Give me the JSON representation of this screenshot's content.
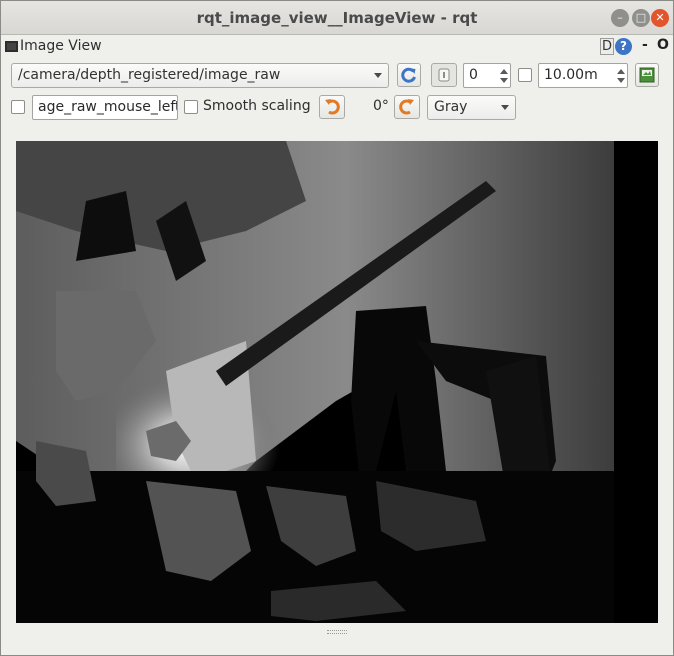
{
  "window": {
    "title": "rqt_image_view__ImageView - rqt",
    "minimize_glyph": "–",
    "maximize_glyph": "□",
    "close_glyph": "✕"
  },
  "plugin": {
    "title": "Image View",
    "d_button": "D",
    "help_glyph": "?",
    "dash_glyph": "-",
    "o_glyph": "O"
  },
  "toolbar1": {
    "topic": "/camera/depth_registered/image_raw",
    "spin_value": "0",
    "max_value": "10.00m"
  },
  "toolbar2": {
    "mouse_topic": "age_raw_mouse_left",
    "smooth_label": "Smooth scaling",
    "rotation": "0°",
    "colormap": "Gray"
  },
  "icons": {
    "refresh": "refresh-icon",
    "zoom_one": "zoom-1-icon",
    "save": "save-image-icon",
    "rotate_left": "rotate-left-icon",
    "rotate_right": "rotate-right-icon"
  },
  "colors": {
    "accent_blue": "#3d74c6",
    "orange": "#e07a26",
    "close_button": "#e2542b"
  }
}
